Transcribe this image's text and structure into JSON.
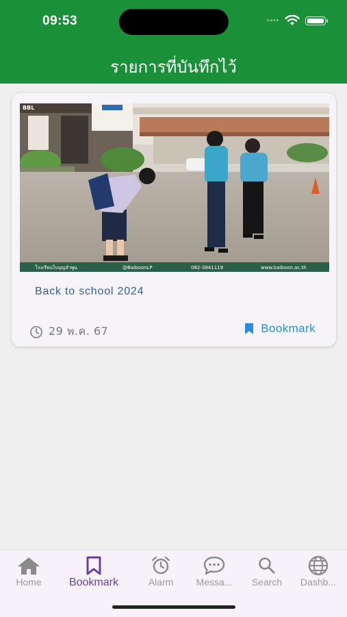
{
  "status": {
    "time": "09:53",
    "signal": "••••"
  },
  "header": {
    "title": "รายการที่บันทึกไว้"
  },
  "card": {
    "title": "Back to school 2024",
    "date": "29 พ.ค. 67",
    "bookmark_label": "Bookmark",
    "photo_caption": {
      "logo": "BBL",
      "left": "โรงเรียนไบบุญลำพูน",
      "handle": "@BaiboonLP",
      "phone": "082-3841119",
      "website": "www.baiboon.ac.th"
    }
  },
  "tabs": [
    {
      "label": "Home",
      "icon": "home-icon"
    },
    {
      "label": "Bookmark",
      "icon": "bookmark-icon",
      "active": true
    },
    {
      "label": "Alarm",
      "icon": "alarm-icon"
    },
    {
      "label": "Messa...",
      "icon": "message-icon"
    },
    {
      "label": "Search",
      "icon": "search-icon"
    },
    {
      "label": "Dashb...",
      "icon": "globe-icon"
    }
  ],
  "colors": {
    "header_green": "#1a9138",
    "accent_purple": "#6a3fa0",
    "link_blue": "#2a8ddc"
  }
}
